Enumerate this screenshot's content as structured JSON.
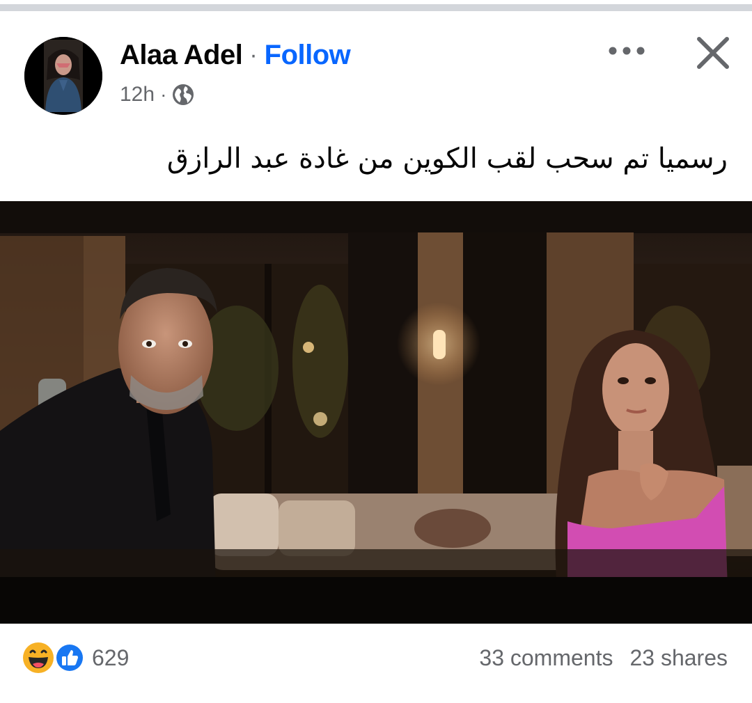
{
  "post": {
    "author": "Alaa Adel",
    "separator": "·",
    "follow_label": "Follow",
    "time": "12h",
    "audience_icon": "globe-icon",
    "text": "رسميا تم سحب لقب الكوين من غادة عبد الرازق"
  },
  "header_actions": {
    "more_icon": "more-options-icon",
    "close_icon": "close-icon"
  },
  "engagement": {
    "reaction_icons": [
      "haha-icon",
      "like-icon"
    ],
    "reaction_count": "629",
    "comments": "33 comments",
    "shares": "23 shares"
  },
  "colors": {
    "follow": "#0866ff",
    "secondary_text": "#65676b",
    "like_blue": "#1877f2",
    "haha_yellow": "#f7b125"
  }
}
